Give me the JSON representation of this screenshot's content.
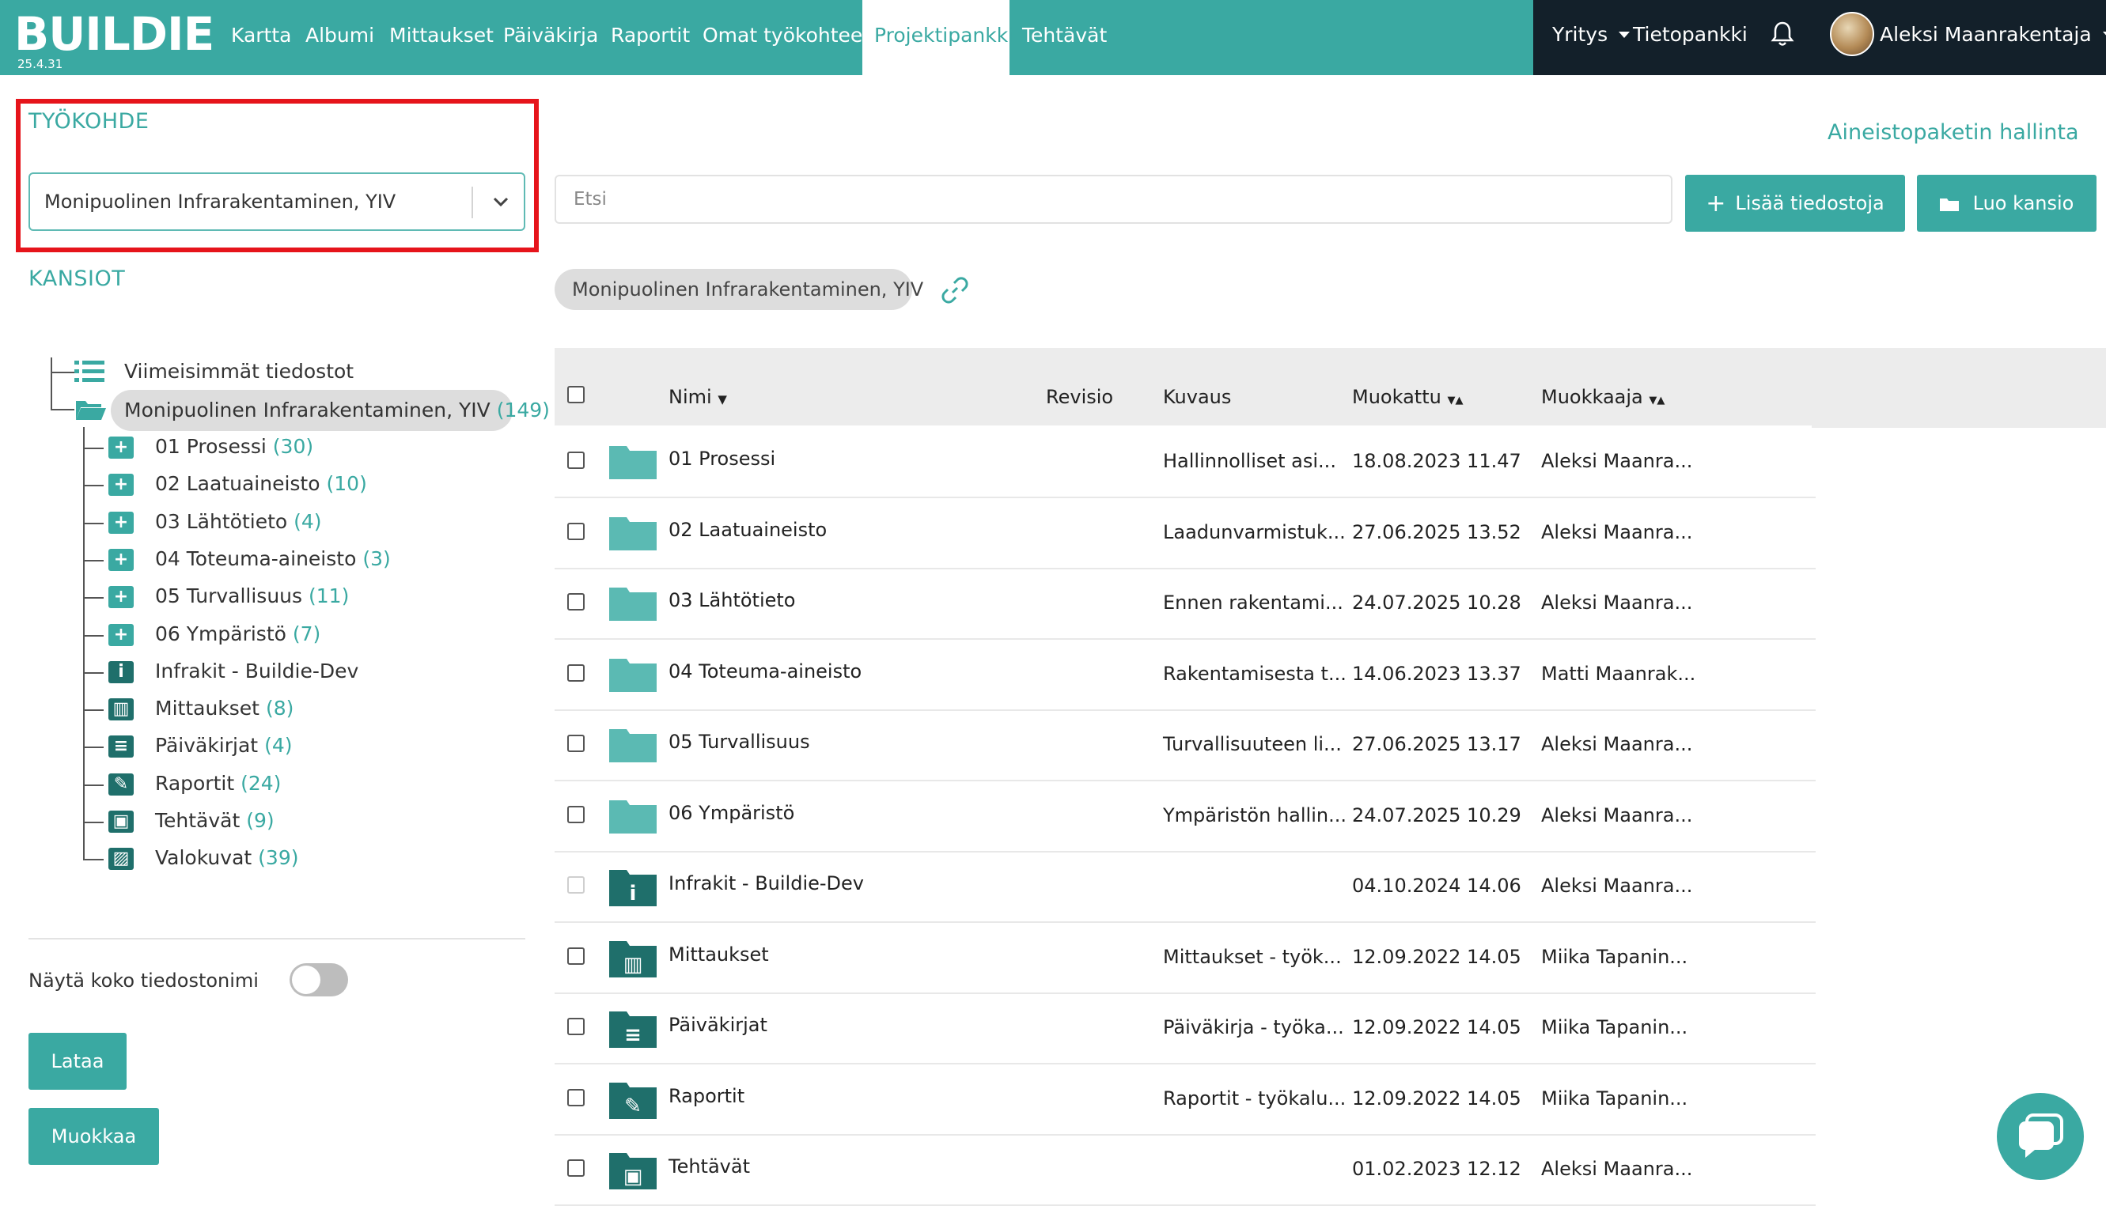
{
  "app": {
    "logo": "BUILDIE",
    "version": "25.4.31"
  },
  "nav": {
    "items": [
      "Kartta",
      "Albumi",
      "Mittaukset",
      "Päiväkirja",
      "Raportit",
      "Omat työkohteet",
      "Projektipankki",
      "Tehtävät"
    ],
    "active": "Projektipankki"
  },
  "topright": {
    "company": "Yritys",
    "knowledge": "Tietopankki",
    "user": "Aleksi Maanrakentaja"
  },
  "left": {
    "worksite_label": "TYÖKOHDE",
    "worksite_value": "Monipuolinen Infrarakentaminen, YIV",
    "folders_label": "KANSIOT",
    "recent": "Viimeisimmät tiedostot",
    "root": {
      "name": "Monipuolinen Infrarakentaminen, YIV",
      "count": "(149)"
    },
    "children": [
      {
        "name": "01 Prosessi",
        "count": "(30)",
        "icon": "plus-folder-icon"
      },
      {
        "name": "02 Laatuaineisto",
        "count": "(10)",
        "icon": "plus-folder-icon"
      },
      {
        "name": "03 Lähtötieto",
        "count": "(4)",
        "icon": "plus-folder-icon"
      },
      {
        "name": "04 Toteuma-aineisto",
        "count": "(3)",
        "icon": "plus-folder-icon"
      },
      {
        "name": "05 Turvallisuus",
        "count": "(11)",
        "icon": "plus-folder-icon"
      },
      {
        "name": "06 Ympäristö",
        "count": "(7)",
        "icon": "plus-folder-icon"
      },
      {
        "name": "Infrakit - Buildie-Dev",
        "count": "",
        "icon": "info-icon"
      },
      {
        "name": "Mittaukset",
        "count": "(8)",
        "icon": "chart-icon"
      },
      {
        "name": "Päiväkirjat",
        "count": "(4)",
        "icon": "diary-icon"
      },
      {
        "name": "Raportit",
        "count": "(24)",
        "icon": "report-icon"
      },
      {
        "name": "Tehtävät",
        "count": "(9)",
        "icon": "task-icon"
      },
      {
        "name": "Valokuvat",
        "count": "(39)",
        "icon": "photo-icon"
      }
    ],
    "toggle_label": "Näytä koko tiedostonimi",
    "toggle_on": false,
    "btn_download": "Lataa",
    "btn_edit": "Muokkaa"
  },
  "main": {
    "manage_link": "Aineistopaketin hallinta",
    "search_placeholder": "Etsi",
    "btn_add_files": "Lisää tiedostoja",
    "btn_new_folder": "Luo kansio",
    "breadcrumb": "Monipuolinen Infrarakentaminen, YIV",
    "columns": [
      "Nimi",
      "Revisio",
      "Kuvaus",
      "Muokattu",
      "Muokkaaja"
    ],
    "rows": [
      {
        "name": "01 Prosessi",
        "desc": "Hallinnolliset asi...",
        "modified": "18.08.2023 11.47",
        "editor": "Aleksi Maanra...",
        "type": "folder"
      },
      {
        "name": "02 Laatuaineisto",
        "desc": "Laadunvarmistuk...",
        "modified": "27.06.2025 13.52",
        "editor": "Aleksi Maanra...",
        "type": "folder"
      },
      {
        "name": "03 Lähtötieto",
        "desc": "Ennen rakentami...",
        "modified": "24.07.2025 10.28",
        "editor": "Aleksi Maanra...",
        "type": "folder"
      },
      {
        "name": "04 Toteuma-aineisto",
        "desc": "Rakentamisesta t...",
        "modified": "14.06.2023 13.37",
        "editor": "Matti Maanrak...",
        "type": "folder"
      },
      {
        "name": "05 Turvallisuus",
        "desc": "Turvallisuuteen li...",
        "modified": "27.06.2025 13.17",
        "editor": "Aleksi Maanra...",
        "type": "folder"
      },
      {
        "name": "06 Ympäristö",
        "desc": "Ympäristön hallin...",
        "modified": "24.07.2025 10.29",
        "editor": "Aleksi Maanra...",
        "type": "folder"
      },
      {
        "name": "Infrakit - Buildie-Dev",
        "desc": "",
        "modified": "04.10.2024 14.06",
        "editor": "Aleksi Maanra...",
        "type": "info"
      },
      {
        "name": "Mittaukset",
        "desc": "Mittaukset - työk...",
        "modified": "12.09.2022 14.05",
        "editor": "Miika Tapanin...",
        "type": "chart"
      },
      {
        "name": "Päiväkirjat",
        "desc": "Päiväkirja - työka...",
        "modified": "12.09.2022 14.05",
        "editor": "Miika Tapanin...",
        "type": "diary"
      },
      {
        "name": "Raportit",
        "desc": "Raportit - työkalu...",
        "modified": "12.09.2022 14.05",
        "editor": "Miika Tapanin...",
        "type": "report"
      },
      {
        "name": "Tehtävät",
        "desc": "",
        "modified": "01.02.2023 12.12",
        "editor": "Aleksi Maanra...",
        "type": "task"
      }
    ]
  },
  "colors": {
    "accent": "#3aa9a2",
    "dark": "#13202a",
    "highlight": "#e6141b"
  }
}
